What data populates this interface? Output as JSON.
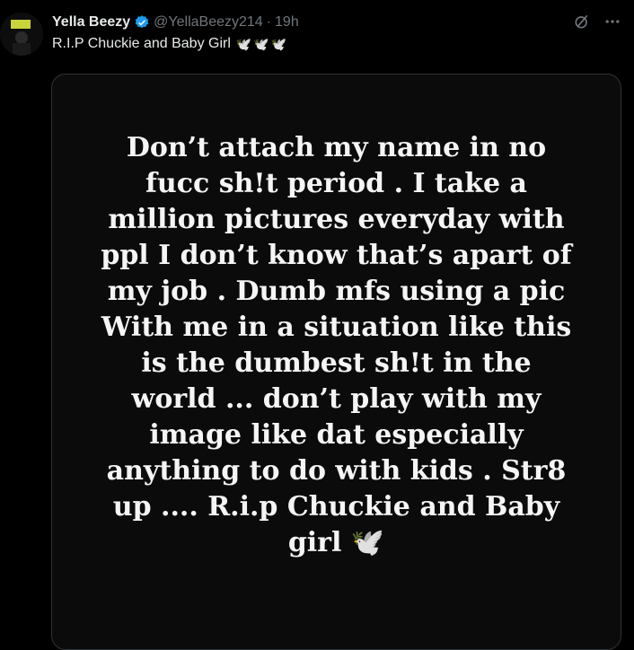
{
  "user": {
    "name": "Yella Beezy",
    "handle": "@YellaBeezy214",
    "separator": "·",
    "time": "19h"
  },
  "tweet": {
    "text": "R.I.P Chuckie and Baby Girl",
    "emojis": "🕊️🕊️🕊️"
  },
  "story": {
    "lines": [
      "Don’t attach my name in no",
      "fucc sh!t period . I take a",
      "million pictures everyday with",
      "ppl I don’t know that’s apart of",
      "my job . Dumb mfs using a pic",
      "With me in a situation like this",
      "is the dumbest sh!t in the",
      "world ... don’t play with my",
      "image like dat especially",
      "anything to do with kids . Str8",
      "up .... R.i.p Chuckie and Baby",
      "girl 🕊️"
    ]
  },
  "icons": {
    "verified": "verified-badge-icon",
    "grok": "grok-icon",
    "more": "more-icon"
  },
  "colors": {
    "background": "#000000",
    "verified": "#1d9bf0",
    "muted": "#71767b",
    "text": "#e7e9ea"
  }
}
